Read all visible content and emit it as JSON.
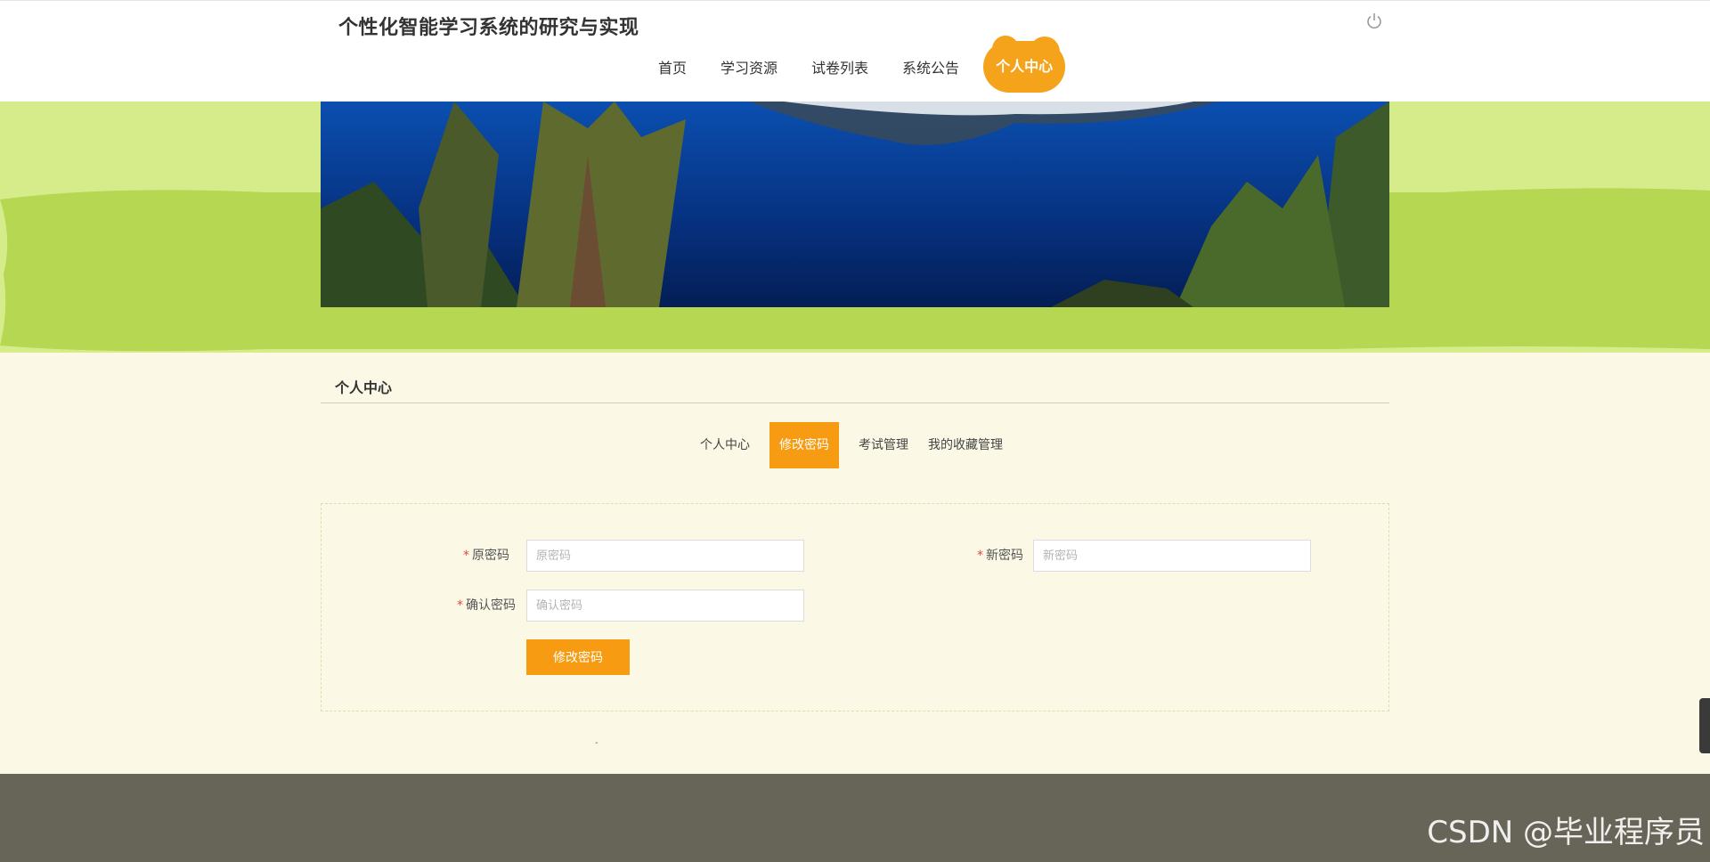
{
  "header": {
    "site_title": "个性化智能学习系统的研究与实现",
    "nav": [
      {
        "label": "首页"
      },
      {
        "label": "学习资源"
      },
      {
        "label": "试卷列表"
      },
      {
        "label": "系统公告"
      },
      {
        "label": "个人中心",
        "active": true
      }
    ]
  },
  "section": {
    "title": "个人中心"
  },
  "tabs": [
    {
      "label": "个人中心"
    },
    {
      "label": "修改密码",
      "active": true
    },
    {
      "label": "考试管理"
    },
    {
      "label": "我的收藏管理"
    }
  ],
  "form": {
    "old_password": {
      "label": "原密码",
      "placeholder": "原密码",
      "value": ""
    },
    "new_password": {
      "label": "新密码",
      "placeholder": "新密码",
      "value": ""
    },
    "confirm_password": {
      "label": "确认密码",
      "placeholder": "确认密码",
      "value": ""
    },
    "submit_label": "修改密码",
    "required_mark": "*"
  },
  "footer": {
    "dot": "-",
    "watermark": "CSDN @毕业程序员"
  },
  "colors": {
    "accent": "#f79c12",
    "band_light": "#d6ec8a",
    "band_green": "#b5d752",
    "footer": "#676558",
    "page_bg": "#fbf9e6"
  }
}
